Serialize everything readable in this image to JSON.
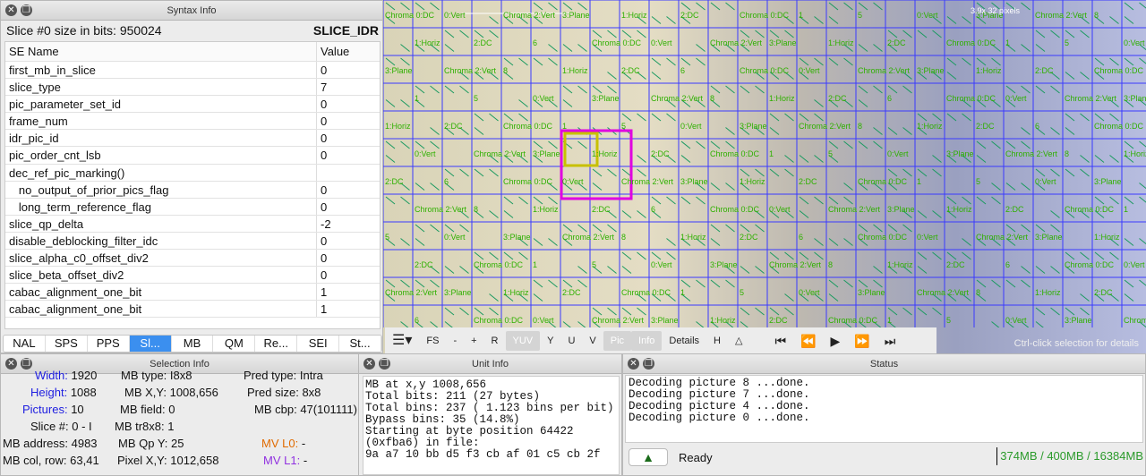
{
  "syntax": {
    "title": "Syntax Info",
    "slice_label": "Slice #0 size in bits:  950024",
    "slice_type": "SLICE_IDR",
    "columns": [
      "SE Name",
      "Value"
    ],
    "rows": [
      [
        "first_mb_in_slice",
        "0"
      ],
      [
        "slice_type",
        "7"
      ],
      [
        "pic_parameter_set_id",
        "0"
      ],
      [
        "frame_num",
        "0"
      ],
      [
        "idr_pic_id",
        "0"
      ],
      [
        "pic_order_cnt_lsb",
        "0"
      ],
      [
        "dec_ref_pic_marking()",
        ""
      ],
      [
        "   no_output_of_prior_pics_flag",
        "0"
      ],
      [
        "   long_term_reference_flag",
        "0"
      ],
      [
        "slice_qp_delta",
        "-2"
      ],
      [
        "disable_deblocking_filter_idc",
        "0"
      ],
      [
        "slice_alpha_c0_offset_div2",
        "0"
      ],
      [
        "slice_beta_offset_div2",
        "0"
      ],
      [
        "cabac_alignment_one_bit",
        "1"
      ],
      [
        "cabac_alignment_one_bit",
        "1"
      ]
    ],
    "tabs": [
      "NAL",
      "SPS",
      "PPS",
      "Sl...",
      "MB",
      "QM",
      "Re...",
      "SEI",
      "St..."
    ],
    "active_tab": 3
  },
  "video": {
    "zoom_label": "3.9x  32 pixels",
    "hint": "Ctrl-click selection for details",
    "overlay_labels": [
      "Chroma 0:DC",
      "0:Vert",
      "Chroma 2:Vert",
      "3:Plane",
      "1:Horiz",
      "2:DC",
      "Chroma 0:DC",
      "1",
      "5",
      "0:Vert",
      "3:Plane",
      "Chroma 2:Vert",
      "8",
      "1:Horiz",
      "2:DC",
      "6"
    ],
    "grid_color": "#3a3aff",
    "label_color": "#2fb000",
    "selection_colors": [
      "#e000e0",
      "#c8c000"
    ]
  },
  "toolbar": {
    "items": [
      "☰▾",
      "FS",
      "-",
      "+",
      "R",
      "YUV",
      "Y",
      "U",
      "V",
      "Pic",
      "Info",
      "Details",
      "H",
      "△",
      "⏮",
      "⏪",
      "▶",
      "⏩",
      "⏭"
    ],
    "active": [
      "YUV",
      "Pic",
      "Info"
    ]
  },
  "selection": {
    "title": "Selection Info",
    "fields": [
      {
        "label": "Width:",
        "value": "1920",
        "color": "#2020e0"
      },
      {
        "label": "Height:",
        "value": "1088",
        "color": "#2020e0"
      },
      {
        "label": "Pictures:",
        "value": "10",
        "color": "#2020e0"
      },
      {
        "label": "Slice #:",
        "value": "0 - I"
      },
      {
        "label": "MB address:",
        "value": "4983"
      },
      {
        "label": "MB col, row:",
        "value": "63,41"
      },
      {
        "label": "MB type:",
        "value": "I8x8"
      },
      {
        "label": "MB X,Y:",
        "value": "1008,656"
      },
      {
        "label": "MB field:",
        "value": "0"
      },
      {
        "label": "MB tr8x8:",
        "value": "1"
      },
      {
        "label": "MB Qp Y:",
        "value": "25"
      },
      {
        "label": "Pixel X,Y:",
        "value": "1012,658"
      },
      {
        "label": "Pred type:",
        "value": "Intra"
      },
      {
        "label": "Pred size:",
        "value": "8x8"
      },
      {
        "label": "MB cbp:",
        "value": "47(101111)"
      },
      {
        "label": "MV L0:",
        "value": "-",
        "color": "#e06a00"
      },
      {
        "label": "MV L1:",
        "value": "-",
        "color": "#9030e0"
      }
    ]
  },
  "unit": {
    "title": "Unit Info",
    "text": "MB at x,y 1008,656\nTotal bits: 211 (27 bytes)\nTotal bins: 237 ( 1.123 bins per bit)\nBypass bins: 35 (14.8%)\nStarting at byte position 64422 (0xfba6) in file:\n9a a7 10 bb d5 f3 cb af 01 c5 cb 2f"
  },
  "status": {
    "title": "Status",
    "log": "Decoding picture 8 ...done.\nDecoding picture 7 ...done.\nDecoding picture 4 ...done.\nDecoding picture 0 ...done.",
    "state": "Ready",
    "memory": "374MB / 400MB / 16384MB",
    "warning_icon": "warning-triangle-icon"
  }
}
